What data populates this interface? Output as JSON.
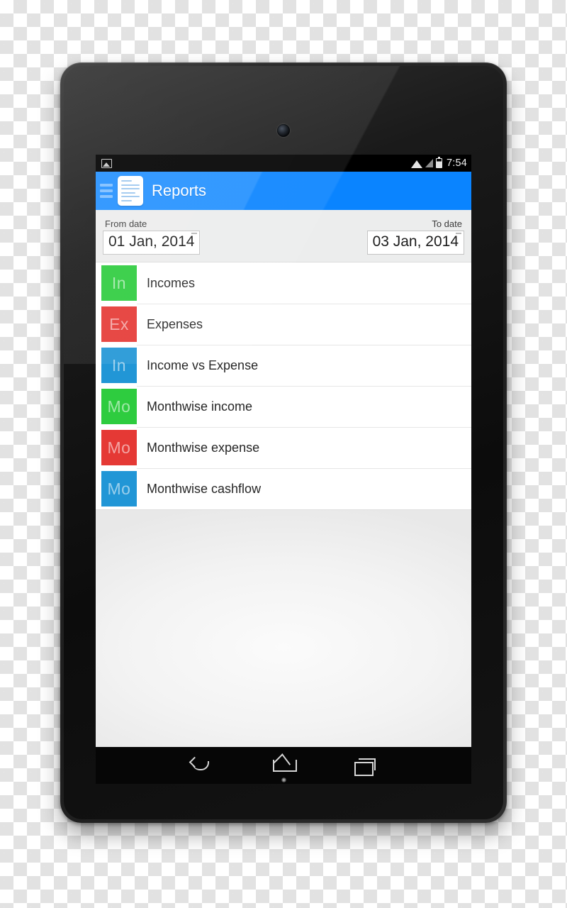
{
  "device": {
    "camera_icon": "front-camera-icon",
    "led_icon": "notification-led-icon"
  },
  "statusbar": {
    "notification_icon": "image-notification-icon",
    "wifi_icon": "wifi-icon",
    "signal_icon": "signal-icon",
    "battery_icon": "battery-icon",
    "time": "7:54"
  },
  "appbar": {
    "menu_icon": "hamburger-menu-icon",
    "app_icon": "report-document-icon",
    "title": "Reports",
    "background_color": "#0a84ff"
  },
  "daterange": {
    "from_label": "From date",
    "from_value": "01 Jan, 2014",
    "to_label": "To date",
    "to_value": "03 Jan, 2014"
  },
  "reports": [
    {
      "badge": "In",
      "label": "Incomes",
      "color": "#2ecc3f"
    },
    {
      "badge": "Ex",
      "label": "Expenses",
      "color": "#e53935"
    },
    {
      "badge": "In",
      "label": "Income vs Expense",
      "color": "#2196d6"
    },
    {
      "badge": "Mo",
      "label": "Monthwise income",
      "color": "#2ecc3f"
    },
    {
      "badge": "Mo",
      "label": "Monthwise expense",
      "color": "#e53935"
    },
    {
      "badge": "Mo",
      "label": "Monthwise cashflow",
      "color": "#2196d6"
    }
  ],
  "navbar": {
    "back_icon": "back-navigation-icon",
    "home_icon": "home-navigation-icon",
    "recents_icon": "recents-navigation-icon"
  }
}
